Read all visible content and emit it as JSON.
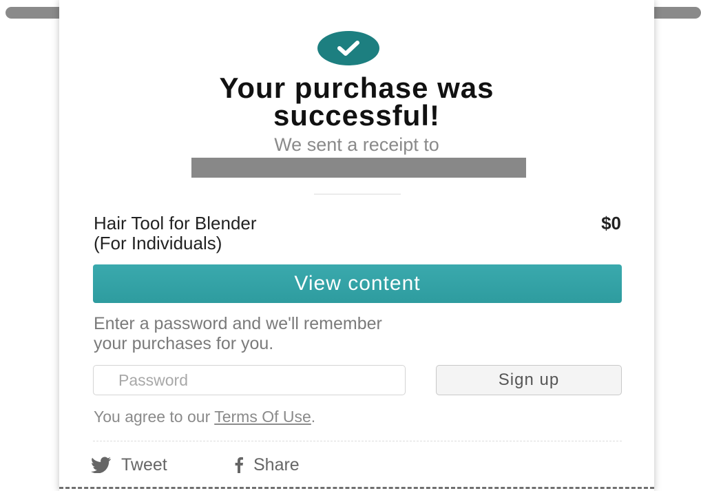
{
  "modal": {
    "headline_line1": "Your purchase was",
    "headline_line2": "successful!",
    "receipt_text": "We sent a receipt to",
    "product": {
      "name_line1": "Hair Tool for Blender",
      "name_line2": "(For Individuals)",
      "price": "$0"
    },
    "view_button_label": "View content",
    "password_prompt_line1": "Enter a password and we'll remember",
    "password_prompt_line2": "your purchases for you.",
    "password_placeholder": "Password",
    "signup_label": "Sign up",
    "terms_prefix": "You agree to our ",
    "terms_link": "Terms Of Use",
    "terms_suffix": ".",
    "social": {
      "tweet_label": "Tweet",
      "tweet_icon": "twitter-bird-icon",
      "share_label": "Share",
      "share_icon": "facebook-f-icon"
    },
    "success_icon": "checkmark-icon"
  },
  "colors": {
    "accent_teal": "#2e9c9f",
    "success_circle": "#1d7f80",
    "muted_text": "#8a8a8a",
    "redaction": "#888888"
  }
}
